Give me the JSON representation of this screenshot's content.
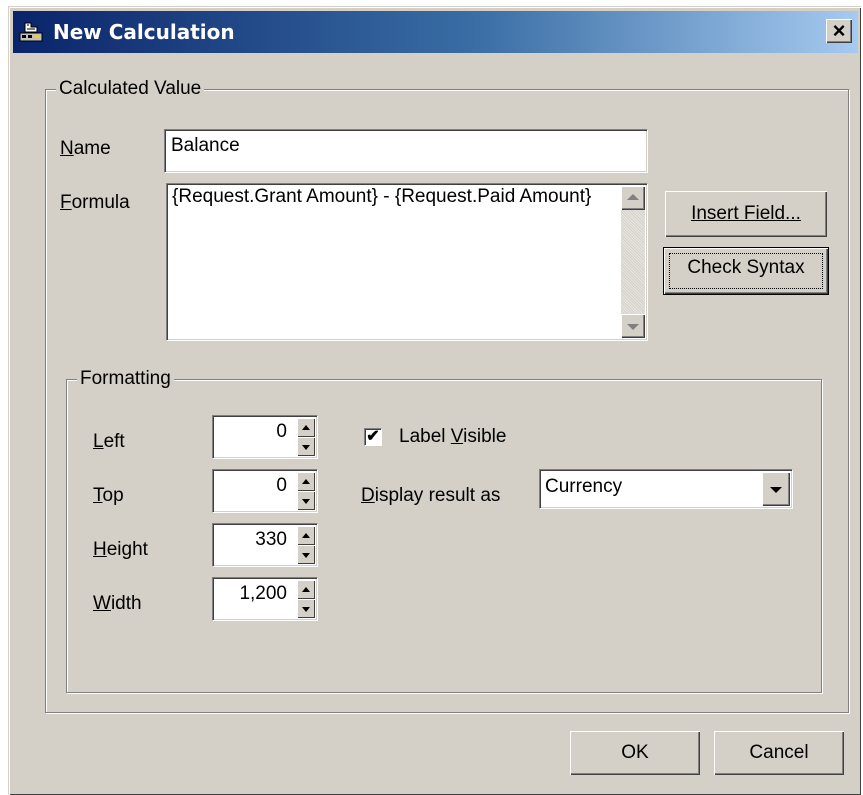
{
  "window": {
    "title": "New Calculation",
    "close_glyph": "×"
  },
  "calculated_value": {
    "legend": "Calculated Value",
    "name_label": "Name",
    "name_value": "Balance",
    "formula_label": "Formula",
    "formula_value": "{Request.Grant Amount} - {Request.Paid Amount}",
    "insert_field_label": "Insert Field...",
    "check_syntax_label": "Check Syntax"
  },
  "formatting": {
    "legend": "Formatting",
    "left_label": "Left",
    "left_value": "0",
    "top_label": "Top",
    "top_value": "0",
    "height_label": "Height",
    "height_value": "330",
    "width_label": "Width",
    "width_value": "1,200",
    "label_visible_label": "Label Visible",
    "label_visible_checked": true,
    "display_result_label": "Display result as",
    "display_result_value": "Currency"
  },
  "footer": {
    "ok_label": "OK",
    "cancel_label": "Cancel"
  },
  "colors": {
    "title_bar_start": "#0a246a",
    "title_bar_end": "#a6caf0",
    "face": "#d4d0c8"
  },
  "icons": {
    "app": "calculation-icon",
    "close": "close-icon",
    "scroll_up": "scroll-up-arrow-icon",
    "scroll_down": "scroll-down-arrow-icon",
    "spin": "spin-arrows-icon",
    "dropdown": "dropdown-arrow-icon",
    "check": "checkmark-icon"
  }
}
